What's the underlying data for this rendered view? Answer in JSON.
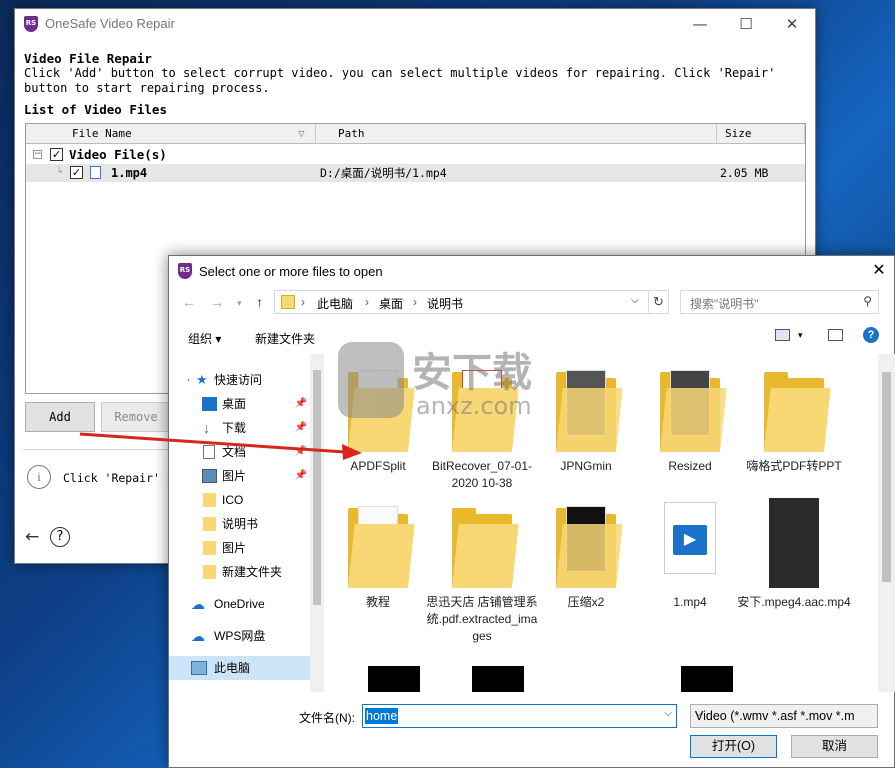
{
  "main_window": {
    "title": "OneSafe Video Repair",
    "heading": "Video File Repair",
    "instructions": "Click 'Add' button to select corrupt video. you can select multiple videos for repairing. Click 'Repair' button to start repairing process.",
    "list_heading": "List of Video Files",
    "columns": [
      "File Name",
      "Path",
      "Size"
    ],
    "group_label": "Video File(s)",
    "file": {
      "name": "1.mp4",
      "path": "D:/桌面/说明书/1.mp4",
      "size": "2.05 MB"
    },
    "add_label": "Add",
    "remove_label": "Remove",
    "hint_text": "Click 'Repair' bu",
    "controls": {
      "minimize": "—",
      "maximize": "☐",
      "close": "✕"
    }
  },
  "dialog": {
    "title": "Select one or more files to open",
    "breadcrumb": [
      "此电脑",
      "桌面",
      "说明书"
    ],
    "search_placeholder": "搜索\"说明书\"",
    "organize_label": "组织 ▾",
    "new_folder_label": "新建文件夹",
    "nav_items": [
      {
        "label": "快速访问"
      },
      {
        "label": "桌面"
      },
      {
        "label": "下载"
      },
      {
        "label": "文档"
      },
      {
        "label": "图片"
      },
      {
        "label": "ICO"
      },
      {
        "label": "说明书"
      },
      {
        "label": "图片"
      },
      {
        "label": "新建文件夹"
      },
      {
        "label": "OneDrive"
      },
      {
        "label": "WPS网盘"
      },
      {
        "label": "此电脑"
      }
    ],
    "files": [
      {
        "label": "APDFSplit"
      },
      {
        "label": "BitRecover_07-01-2020 10-38"
      },
      {
        "label": "JPNGmin"
      },
      {
        "label": "Resized"
      },
      {
        "label": "嗨格式PDF转PPT"
      },
      {
        "label": "教程"
      },
      {
        "label": "思迅天店 店铺管理系统.pdf.extracted_images"
      },
      {
        "label": "压缩x2"
      },
      {
        "label": "1.mp4"
      },
      {
        "label": "安下.mpeg4.aac.mp4"
      }
    ],
    "filename_label": "文件名(N):",
    "filename_value": "home",
    "filter_value": "Video (*.wmv *.asf *.mov *.m",
    "open_label": "打开(O)",
    "cancel_label": "取消"
  },
  "watermark_text": "安下载",
  "watermark_sub": "anxz.com"
}
